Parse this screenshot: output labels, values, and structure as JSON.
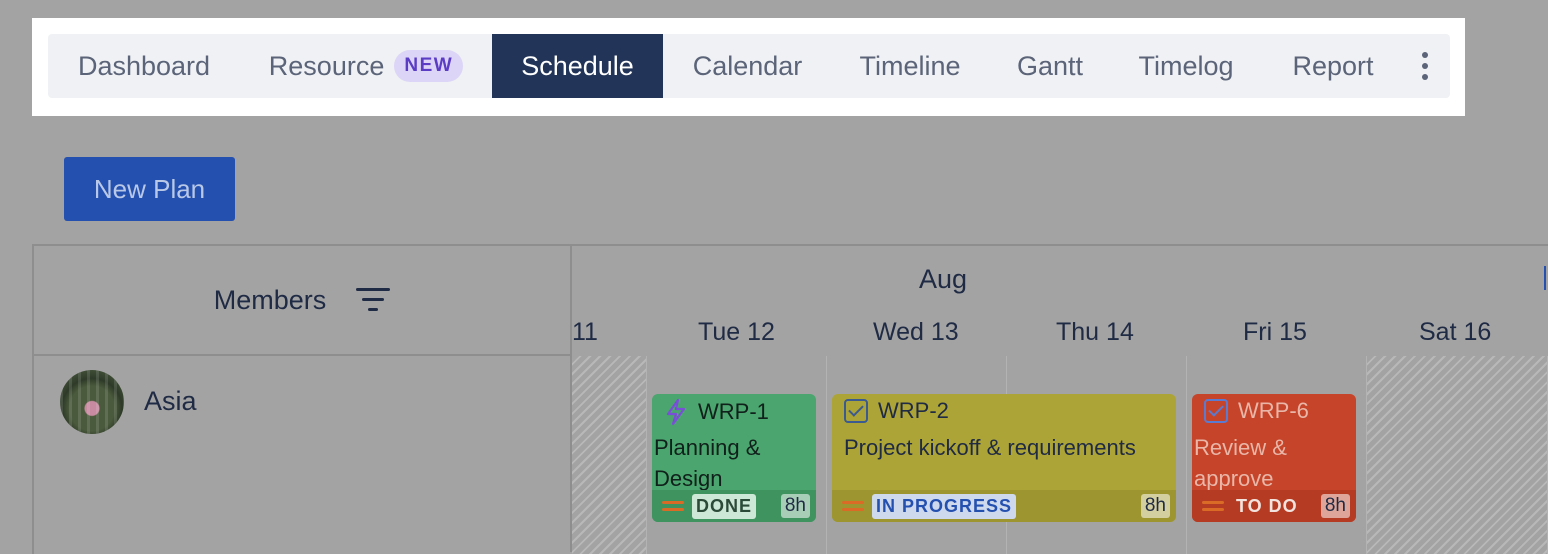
{
  "nav": {
    "tabs": [
      {
        "label": "Dashboard"
      },
      {
        "label": "Resource",
        "badge": "NEW"
      },
      {
        "label": "Schedule",
        "active": true
      },
      {
        "label": "Calendar"
      },
      {
        "label": "Timeline"
      },
      {
        "label": "Gantt"
      },
      {
        "label": "Timelog"
      },
      {
        "label": "Report"
      }
    ],
    "more_icon": "kebab-vertical-icon"
  },
  "actions": {
    "new_plan_label": "New Plan"
  },
  "grid": {
    "members_label": "Members",
    "filter_icon": "filter-icon",
    "month": "Aug",
    "days": [
      {
        "weekday": "",
        "date": "11",
        "weekend": true
      },
      {
        "weekday": "Tue",
        "date": "12"
      },
      {
        "weekday": "Wed",
        "date": "13"
      },
      {
        "weekday": "Thu",
        "date": "14"
      },
      {
        "weekday": "Fri",
        "date": "15"
      },
      {
        "weekday": "Sat",
        "date": "16",
        "weekend": true
      }
    ]
  },
  "members": [
    {
      "name": "Asia",
      "tasks": [
        {
          "key": "WRP-1",
          "title": "Planning & Design",
          "status": "DONE",
          "hours": "8h",
          "icon": "bolt-icon",
          "color": "#4aa56e"
        },
        {
          "key": "WRP-2",
          "title": "Project kickoff & requirements",
          "status": "IN PROGRESS",
          "hours": "8h",
          "icon": "checkbox-icon",
          "color": "#ada437"
        },
        {
          "key": "WRP-6",
          "title": "Review & approve",
          "status": "TO DO",
          "hours": "8h",
          "icon": "checkbox-icon",
          "color": "#c5442a"
        }
      ]
    }
  ],
  "colors": {
    "accent": "#223457",
    "button": "#2450b0",
    "badge": "#dcd5f7",
    "priority": "#d96b27"
  }
}
